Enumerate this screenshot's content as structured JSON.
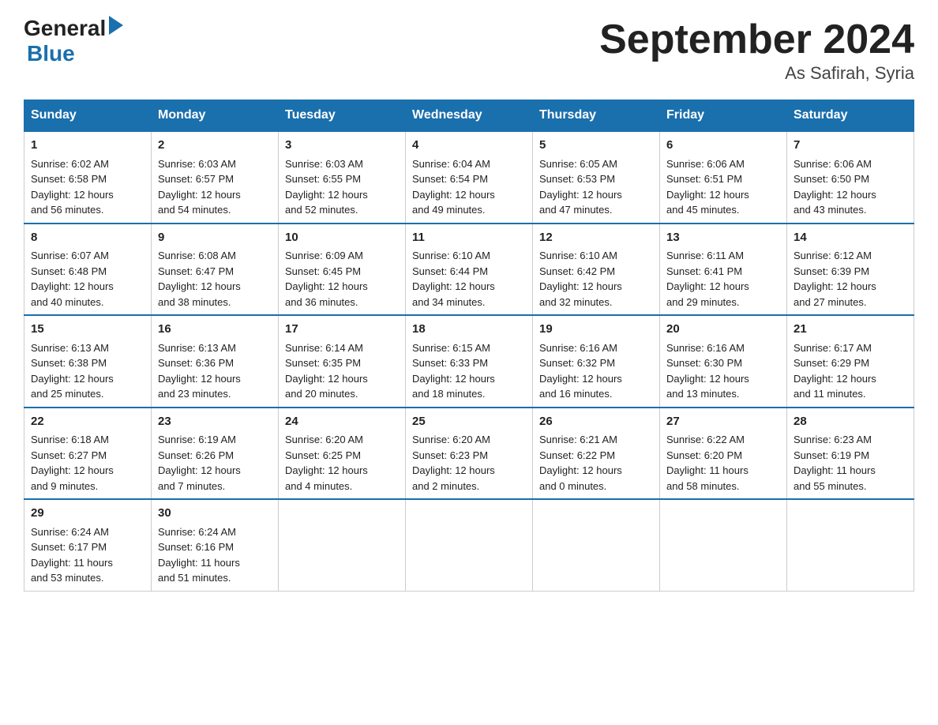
{
  "logo": {
    "text_general": "General",
    "text_blue": "Blue",
    "arrow": "▶"
  },
  "title": "September 2024",
  "subtitle": "As Safirah, Syria",
  "weekdays": [
    "Sunday",
    "Monday",
    "Tuesday",
    "Wednesday",
    "Thursday",
    "Friday",
    "Saturday"
  ],
  "weeks": [
    [
      {
        "day": "1",
        "sunrise": "6:02 AM",
        "sunset": "6:58 PM",
        "daylight": "12 hours and 56 minutes."
      },
      {
        "day": "2",
        "sunrise": "6:03 AM",
        "sunset": "6:57 PM",
        "daylight": "12 hours and 54 minutes."
      },
      {
        "day": "3",
        "sunrise": "6:03 AM",
        "sunset": "6:55 PM",
        "daylight": "12 hours and 52 minutes."
      },
      {
        "day": "4",
        "sunrise": "6:04 AM",
        "sunset": "6:54 PM",
        "daylight": "12 hours and 49 minutes."
      },
      {
        "day": "5",
        "sunrise": "6:05 AM",
        "sunset": "6:53 PM",
        "daylight": "12 hours and 47 minutes."
      },
      {
        "day": "6",
        "sunrise": "6:06 AM",
        "sunset": "6:51 PM",
        "daylight": "12 hours and 45 minutes."
      },
      {
        "day": "7",
        "sunrise": "6:06 AM",
        "sunset": "6:50 PM",
        "daylight": "12 hours and 43 minutes."
      }
    ],
    [
      {
        "day": "8",
        "sunrise": "6:07 AM",
        "sunset": "6:48 PM",
        "daylight": "12 hours and 40 minutes."
      },
      {
        "day": "9",
        "sunrise": "6:08 AM",
        "sunset": "6:47 PM",
        "daylight": "12 hours and 38 minutes."
      },
      {
        "day": "10",
        "sunrise": "6:09 AM",
        "sunset": "6:45 PM",
        "daylight": "12 hours and 36 minutes."
      },
      {
        "day": "11",
        "sunrise": "6:10 AM",
        "sunset": "6:44 PM",
        "daylight": "12 hours and 34 minutes."
      },
      {
        "day": "12",
        "sunrise": "6:10 AM",
        "sunset": "6:42 PM",
        "daylight": "12 hours and 32 minutes."
      },
      {
        "day": "13",
        "sunrise": "6:11 AM",
        "sunset": "6:41 PM",
        "daylight": "12 hours and 29 minutes."
      },
      {
        "day": "14",
        "sunrise": "6:12 AM",
        "sunset": "6:39 PM",
        "daylight": "12 hours and 27 minutes."
      }
    ],
    [
      {
        "day": "15",
        "sunrise": "6:13 AM",
        "sunset": "6:38 PM",
        "daylight": "12 hours and 25 minutes."
      },
      {
        "day": "16",
        "sunrise": "6:13 AM",
        "sunset": "6:36 PM",
        "daylight": "12 hours and 23 minutes."
      },
      {
        "day": "17",
        "sunrise": "6:14 AM",
        "sunset": "6:35 PM",
        "daylight": "12 hours and 20 minutes."
      },
      {
        "day": "18",
        "sunrise": "6:15 AM",
        "sunset": "6:33 PM",
        "daylight": "12 hours and 18 minutes."
      },
      {
        "day": "19",
        "sunrise": "6:16 AM",
        "sunset": "6:32 PM",
        "daylight": "12 hours and 16 minutes."
      },
      {
        "day": "20",
        "sunrise": "6:16 AM",
        "sunset": "6:30 PM",
        "daylight": "12 hours and 13 minutes."
      },
      {
        "day": "21",
        "sunrise": "6:17 AM",
        "sunset": "6:29 PM",
        "daylight": "12 hours and 11 minutes."
      }
    ],
    [
      {
        "day": "22",
        "sunrise": "6:18 AM",
        "sunset": "6:27 PM",
        "daylight": "12 hours and 9 minutes."
      },
      {
        "day": "23",
        "sunrise": "6:19 AM",
        "sunset": "6:26 PM",
        "daylight": "12 hours and 7 minutes."
      },
      {
        "day": "24",
        "sunrise": "6:20 AM",
        "sunset": "6:25 PM",
        "daylight": "12 hours and 4 minutes."
      },
      {
        "day": "25",
        "sunrise": "6:20 AM",
        "sunset": "6:23 PM",
        "daylight": "12 hours and 2 minutes."
      },
      {
        "day": "26",
        "sunrise": "6:21 AM",
        "sunset": "6:22 PM",
        "daylight": "12 hours and 0 minutes."
      },
      {
        "day": "27",
        "sunrise": "6:22 AM",
        "sunset": "6:20 PM",
        "daylight": "11 hours and 58 minutes."
      },
      {
        "day": "28",
        "sunrise": "6:23 AM",
        "sunset": "6:19 PM",
        "daylight": "11 hours and 55 minutes."
      }
    ],
    [
      {
        "day": "29",
        "sunrise": "6:24 AM",
        "sunset": "6:17 PM",
        "daylight": "11 hours and 53 minutes."
      },
      {
        "day": "30",
        "sunrise": "6:24 AM",
        "sunset": "6:16 PM",
        "daylight": "11 hours and 51 minutes."
      },
      null,
      null,
      null,
      null,
      null
    ]
  ],
  "labels": {
    "sunrise": "Sunrise:",
    "sunset": "Sunset:",
    "daylight": "Daylight:"
  }
}
